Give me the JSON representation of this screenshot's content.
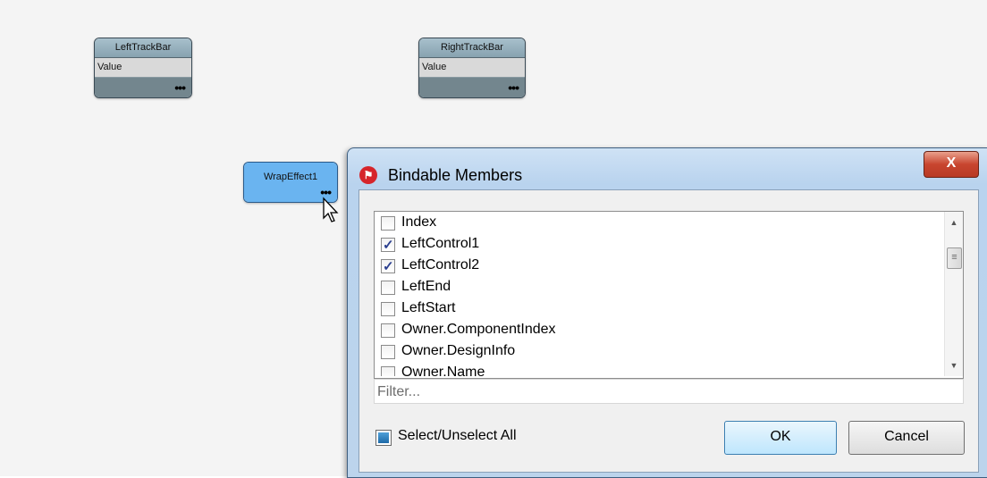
{
  "canvas": {
    "nodes": [
      {
        "title": "LeftTrackBar",
        "row": "Value",
        "more": "•••"
      },
      {
        "title": "RightTrackBar",
        "row": "Value",
        "more": "•••"
      },
      {
        "title": "WrapEffect1",
        "more": "•••"
      }
    ]
  },
  "dialog": {
    "title": "Bindable Members",
    "close_label": "X",
    "members": [
      {
        "label": "Index",
        "checked": false
      },
      {
        "label": "LeftControl1",
        "checked": true
      },
      {
        "label": "LeftControl2",
        "checked": true
      },
      {
        "label": "LeftEnd",
        "checked": false
      },
      {
        "label": "LeftStart",
        "checked": false
      },
      {
        "label": "Owner.ComponentIndex",
        "checked": false
      },
      {
        "label": "Owner.DesignInfo",
        "checked": false
      },
      {
        "label": "Owner.Name",
        "checked": false
      }
    ],
    "filter_placeholder": "Filter...",
    "select_all_label": "Select/Unselect All",
    "ok_label": "OK",
    "cancel_label": "Cancel",
    "check_glyph": "✓"
  },
  "colors": {
    "node_header": "#87a2b0",
    "node_selected": "#6ab4f0",
    "title_icon": "#d6252b",
    "close_button": "#c8452f"
  }
}
